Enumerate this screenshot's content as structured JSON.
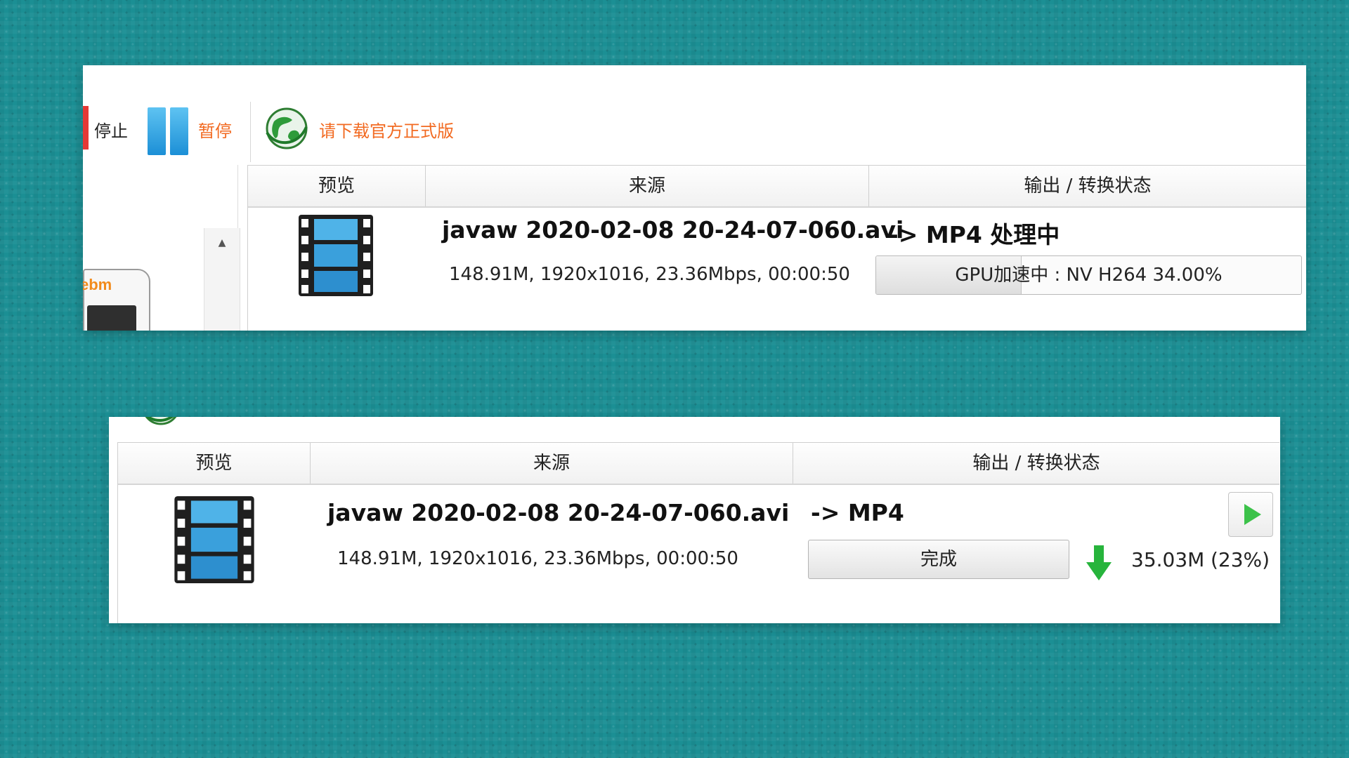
{
  "colors": {
    "background": "#1b8f94",
    "accent_red": "#e53935",
    "accent_orange": "#f26a21",
    "progress_green": "#27b43c"
  },
  "top_panel": {
    "toolbar": {
      "stop_label": "停止",
      "pause_label": "暂停",
      "download_label": "请下载官方正式版",
      "pause_icon": "pause-icon",
      "globe_icon": "globe-icon"
    },
    "left_pane": {
      "format_tag": "ebm",
      "scroll_up": "▲"
    },
    "table": {
      "columns": [
        "预览",
        "来源",
        "输出 / 转换状态"
      ],
      "row": {
        "file_name": "javaw 2020-02-08 20-24-07-060.avi",
        "file_meta": "148.91M, 1920x1016, 23.36Mbps, 00:00:50",
        "output": "-> MP4 处理中",
        "progress_text": "GPU加速中 : NV H264 34.00%",
        "progress_percent": 34
      }
    }
  },
  "bottom_panel": {
    "table": {
      "columns": [
        "预览",
        "来源",
        "输出 / 转换状态"
      ],
      "row": {
        "file_name": "javaw 2020-02-08 20-24-07-060.avi",
        "file_meta": "148.91M, 1920x1016, 23.36Mbps, 00:00:50",
        "output": "-> MP4",
        "status_button": "完成",
        "output_size": "35.03M",
        "output_ratio": "(23%)",
        "play_icon": "play-icon",
        "arrow_icon": "down-arrow-icon"
      }
    }
  }
}
